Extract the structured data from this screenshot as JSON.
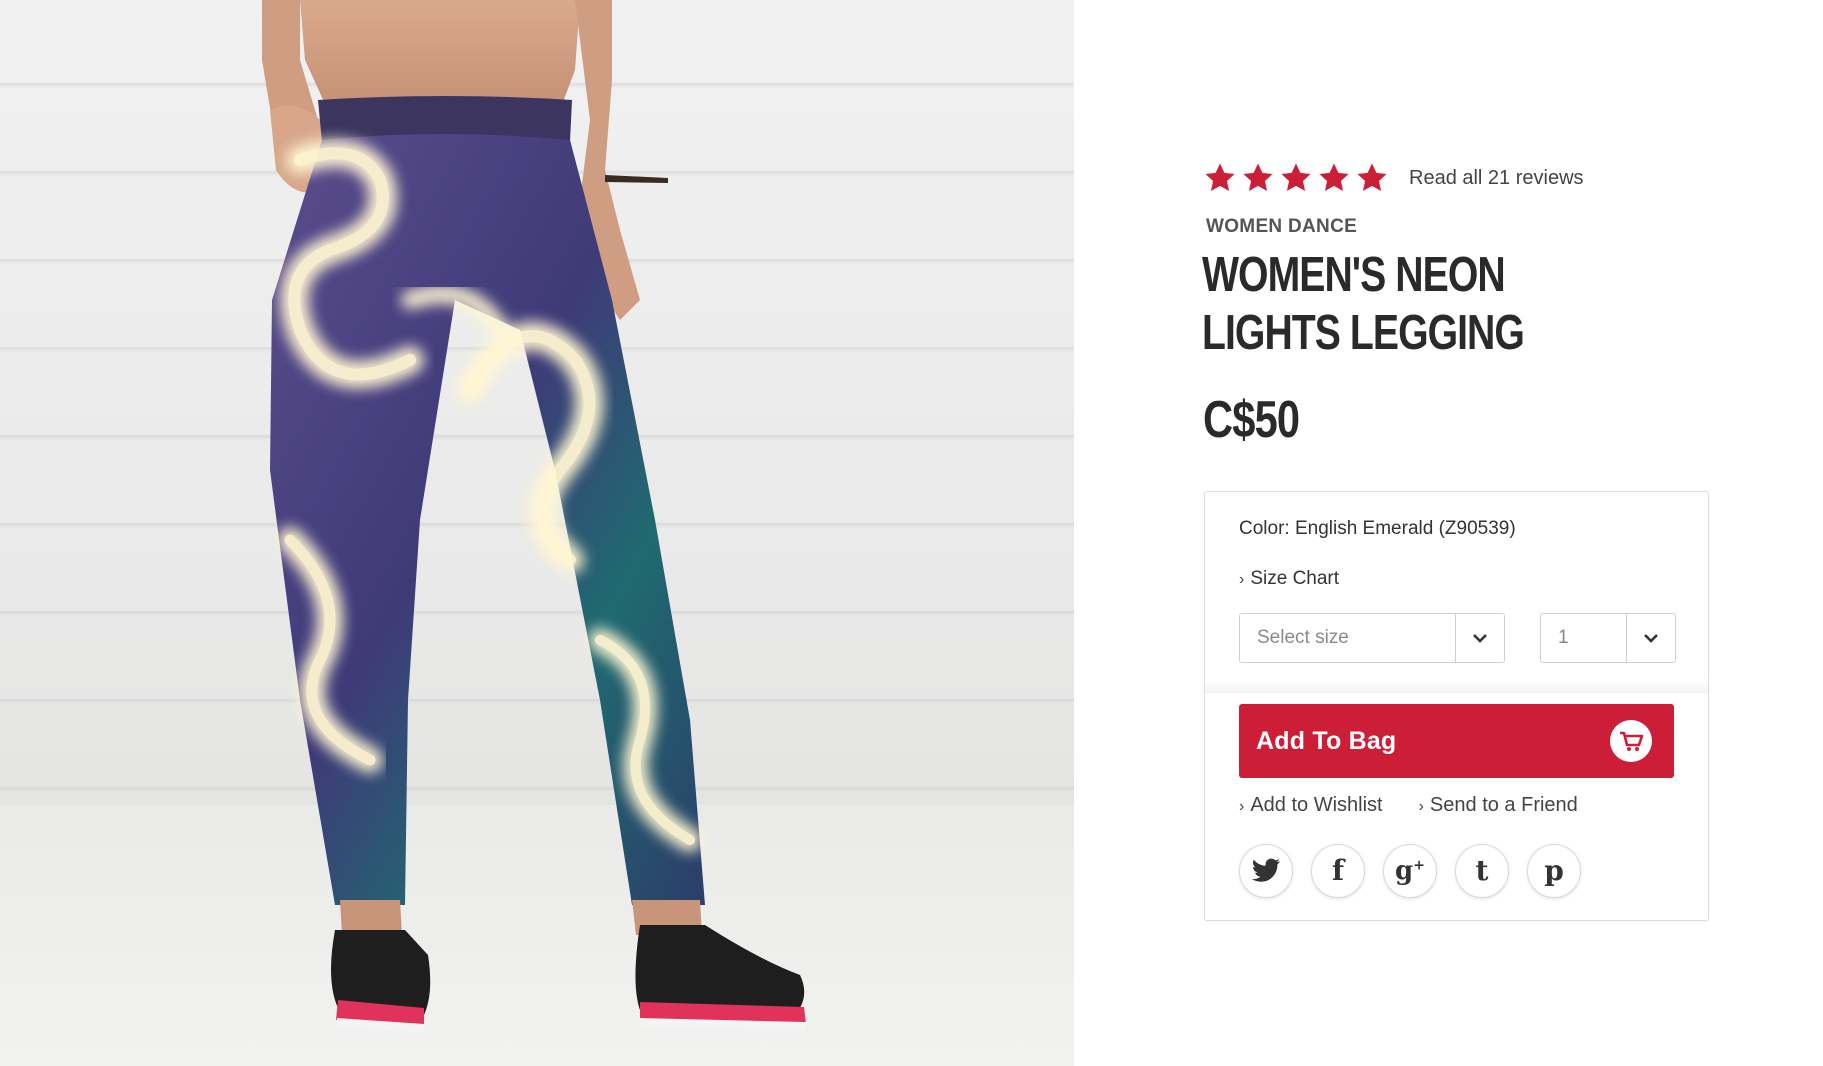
{
  "product": {
    "rating": {
      "stars": 5,
      "max_stars": 5,
      "reviews_link": "Read all 21 reviews",
      "star_color": "#cc1e36"
    },
    "category": "WOMEN DANCE",
    "title": "WOMEN'S NEON LIGHTS LEGGING",
    "price": "C$50"
  },
  "buy_box": {
    "color_text": "Color: English Emerald (Z90539)",
    "size_chart_link": "Size Chart",
    "size_select": {
      "placeholder": "Select size"
    },
    "quantity_select": {
      "value": "1"
    },
    "add_to_bag": {
      "label": "Add To Bag",
      "background": "#cc1e36",
      "icon": "cart-icon"
    },
    "links": {
      "wishlist": "Add to Wishlist",
      "send_friend": "Send to a Friend"
    },
    "social": [
      {
        "name": "twitter",
        "icon": "twitter-icon"
      },
      {
        "name": "facebook",
        "icon": "facebook-icon"
      },
      {
        "name": "google-plus",
        "icon": "google-plus-icon"
      },
      {
        "name": "tumblr",
        "icon": "tumblr-icon"
      },
      {
        "name": "pinterest",
        "icon": "pinterest-icon"
      }
    ]
  },
  "photo": {
    "subject": "product-photo-leggings"
  }
}
